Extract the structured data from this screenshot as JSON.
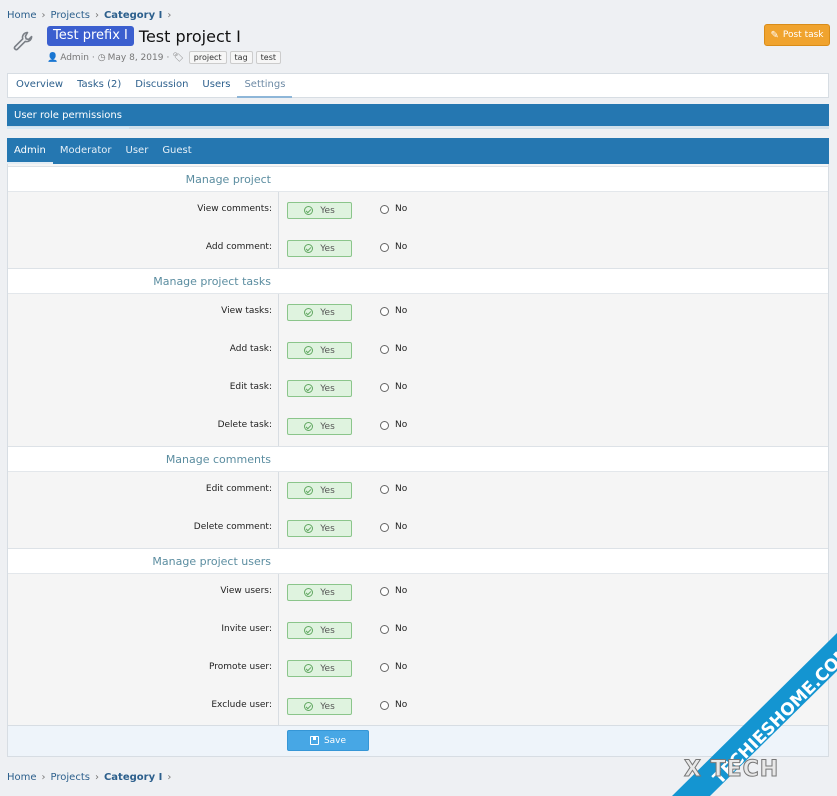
{
  "breadcrumb_top": [
    "Home",
    "Projects",
    "Category I"
  ],
  "breadcrumb_bottom": [
    "Home",
    "Projects",
    "Category I"
  ],
  "header": {
    "prefix": "Test prefix I",
    "title": "Test project I",
    "author": "Admin",
    "date": "May 8, 2019",
    "tags": [
      "project",
      "tag",
      "test"
    ]
  },
  "post_task_label": "Post task",
  "tabs": [
    "Overview",
    "Tasks (2)",
    "Discussion",
    "Users",
    "Settings"
  ],
  "role_tab": "User role permissions",
  "subtabs": [
    "Admin",
    "Moderator",
    "User",
    "Guest"
  ],
  "yes_label": "Yes",
  "no_label": "No",
  "sections": [
    {
      "title": "Manage project",
      "rows": [
        "View comments:",
        "Add comment:"
      ]
    },
    {
      "title": "Manage project tasks",
      "rows": [
        "View tasks:",
        "Add task:",
        "Edit task:",
        "Delete task:"
      ]
    },
    {
      "title": "Manage comments",
      "rows": [
        "Edit comment:",
        "Delete comment:"
      ]
    },
    {
      "title": "Manage project users",
      "rows": [
        "View users:",
        "Invite user:",
        "Promote user:",
        "Exclude user:"
      ]
    }
  ],
  "save_label": "Save",
  "watermark": {
    "top": "X TECH",
    "side": "TECHIESHOME.COM"
  },
  "colors": {
    "accent": "#2577b1",
    "post": "#f0a32e",
    "yes": "#dff3df",
    "save": "#47a7e5",
    "prefix": "#3b5fcf"
  },
  "icons": {
    "header": "wrench-icon",
    "author": "user-icon",
    "date": "clock-icon",
    "tags": "tag-icon",
    "post": "edit-icon",
    "yes": "check-circle-icon",
    "save": "save-icon"
  }
}
